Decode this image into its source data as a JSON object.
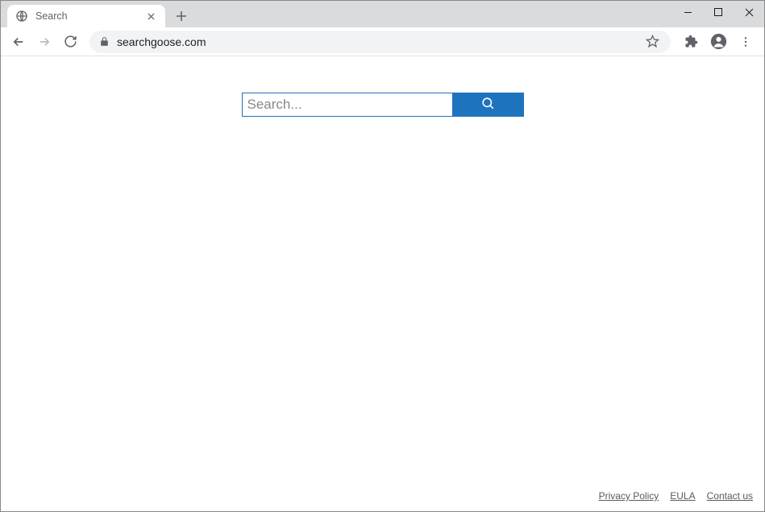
{
  "window": {
    "tab_title": "Search"
  },
  "toolbar": {
    "url": "searchgoose.com"
  },
  "page": {
    "search_placeholder": "Search..."
  },
  "footer": {
    "privacy": "Privacy Policy",
    "eula": "EULA",
    "contact": "Contact us"
  }
}
